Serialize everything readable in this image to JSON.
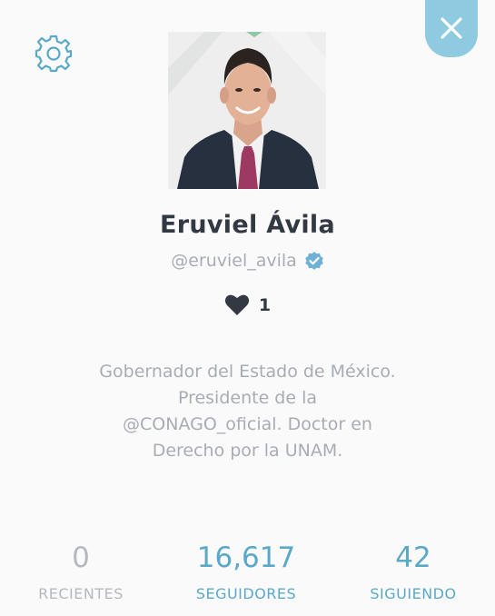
{
  "header": {
    "settings_icon": "gear-icon",
    "close_icon": "close-icon",
    "accent_color": "#8fcbe0"
  },
  "profile": {
    "name": "Eruviel Ávila",
    "handle": "@eruviel_avila",
    "verified": true,
    "verified_icon": "verified-badge-icon",
    "likes_icon": "heart-icon",
    "likes": "1",
    "bio_line1": "Gobernador del Estado de México.",
    "bio_line2": "Presidente de la",
    "bio_link": "@CONAGO_oficial",
    "bio_line3_rest": ". Doctor en",
    "bio_line4": "Derecho por la UNAM."
  },
  "stats": {
    "recent": {
      "value": "0",
      "label": "RECIENTES"
    },
    "followers": {
      "value": "16,617",
      "label": "SEGUIDORES"
    },
    "following": {
      "value": "42",
      "label": "SIGUIENDO"
    }
  }
}
